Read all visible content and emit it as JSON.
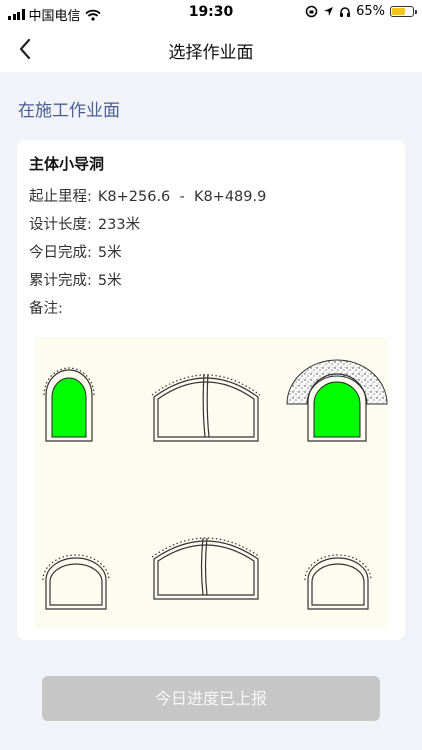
{
  "status_bar": {
    "carrier": "中国电信",
    "time": "19:30",
    "battery_percent": "65%",
    "battery_level": 0.65
  },
  "nav": {
    "title": "选择作业面",
    "back_icon": "chevron-left-icon"
  },
  "section_title": "在施工作业面",
  "card": {
    "title": "主体小导洞",
    "rows": [
      {
        "label": "起止里程:",
        "value": "K8+256.6  -  K8+489.9"
      },
      {
        "label": "设计长度:",
        "value": "233米"
      },
      {
        "label": "今日完成:",
        "value": "5米"
      },
      {
        "label": "累计完成:",
        "value": "5米"
      },
      {
        "label": "备注:",
        "value": ""
      }
    ]
  },
  "diagram": {
    "fill_active": "#00ff00",
    "background": "#fdfcf0",
    "sections": [
      {
        "id": "top-left",
        "shape": "small-tunnel",
        "active": true
      },
      {
        "id": "top-center",
        "shape": "double-tunnel",
        "active": false
      },
      {
        "id": "top-right",
        "shape": "small-tunnel-with-arch",
        "active": true
      },
      {
        "id": "bottom-left",
        "shape": "small-tunnel-low",
        "active": false
      },
      {
        "id": "bottom-center",
        "shape": "double-tunnel-inverted",
        "active": false
      },
      {
        "id": "bottom-right",
        "shape": "small-tunnel-low",
        "active": false
      }
    ]
  },
  "report_button": {
    "label": "今日进度已上报",
    "disabled": true,
    "color": "#c6c6c6"
  }
}
